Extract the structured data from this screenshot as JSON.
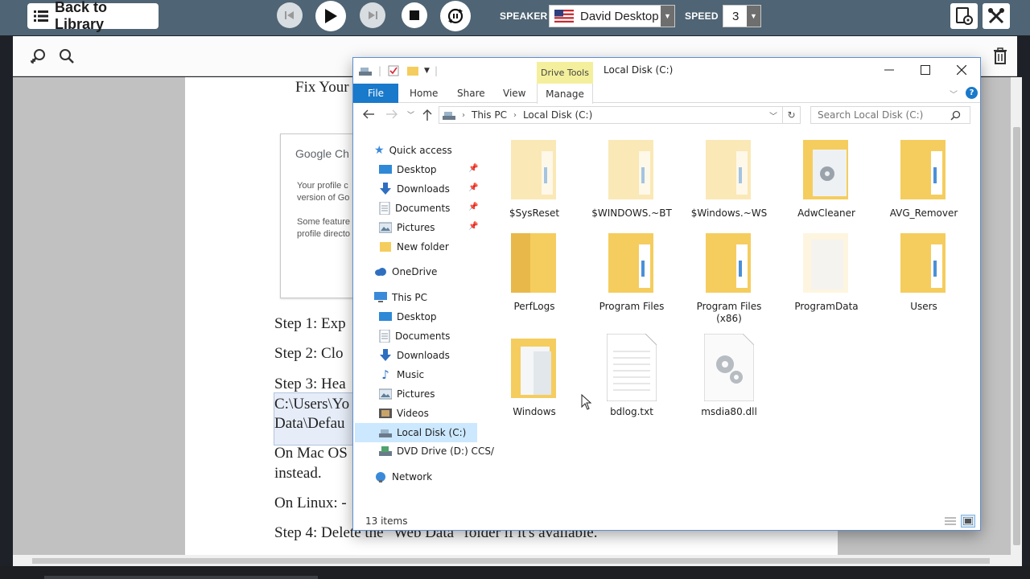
{
  "app": {
    "back_label": "Back to Library",
    "speaker_label": "SPEAKER",
    "speaker_value": "David Desktop",
    "speed_label": "SPEED",
    "speed_value": "3"
  },
  "document": {
    "heading_fragment": "Fix Your",
    "card_title": "Google Ch",
    "card_line1": "Your profile c",
    "card_line2": "version of Go",
    "card_line3": "Some feature",
    "card_line4": "profile directo",
    "step1": "Step 1: Exp",
    "step2": "Step 2: Clo",
    "step3": "Step 3: Hea",
    "path1": "C:\\Users\\Yo",
    "path2": "Data\\Defau",
    "mac1": "On Mac OS",
    "mac2": "instead.",
    "linux": "On Linux: -",
    "step4": "Step 4: Delete the \"Web Data\" folder if it's available."
  },
  "explorer": {
    "window_title": "Local Disk (C:)",
    "context_tab": "Drive Tools",
    "ribbon_tabs": {
      "file": "File",
      "home": "Home",
      "share": "Share",
      "view": "View",
      "manage": "Manage"
    },
    "breadcrumb": {
      "this_pc": "This PC",
      "disk": "Local Disk (C:)"
    },
    "search_placeholder": "Search Local Disk (C:)",
    "nav": {
      "quick_access": "Quick access",
      "qa_desktop": "Desktop",
      "qa_downloads": "Downloads",
      "qa_documents": "Documents",
      "qa_pictures": "Pictures",
      "qa_new_folder": "New folder",
      "onedrive": "OneDrive",
      "this_pc": "This PC",
      "pc_desktop": "Desktop",
      "pc_documents": "Documents",
      "pc_downloads": "Downloads",
      "pc_music": "Music",
      "pc_pictures": "Pictures",
      "pc_videos": "Videos",
      "pc_local_disk": "Local Disk (C:)",
      "pc_dvd": "DVD Drive (D:) CCS/",
      "network": "Network"
    },
    "items": [
      {
        "name": "$SysReset",
        "type": "folder-hidden"
      },
      {
        "name": "$WINDOWS.~BT",
        "type": "folder-hidden"
      },
      {
        "name": "$Windows.~WS",
        "type": "folder-hidden"
      },
      {
        "name": "AdwCleaner",
        "type": "folder-gear"
      },
      {
        "name": "AVG_Remover",
        "type": "folder"
      },
      {
        "name": "PerfLogs",
        "type": "folder-empty"
      },
      {
        "name": "Program Files",
        "type": "folder"
      },
      {
        "name": "Program Files (x86)",
        "type": "folder"
      },
      {
        "name": "ProgramData",
        "type": "folder-hidden-faint"
      },
      {
        "name": "Users",
        "type": "folder"
      },
      {
        "name": "Windows",
        "type": "folder-docs"
      },
      {
        "name": "bdlog.txt",
        "type": "text-file"
      },
      {
        "name": "msdia80.dll",
        "type": "dll-file"
      }
    ],
    "status_count": "13 items"
  },
  "colors": {
    "topbar": "#4f6474",
    "file_tab": "#1979ca",
    "context_tab": "#f4ef9c",
    "nav_selected": "#cce8ff",
    "folder": "#f5cd5e"
  }
}
